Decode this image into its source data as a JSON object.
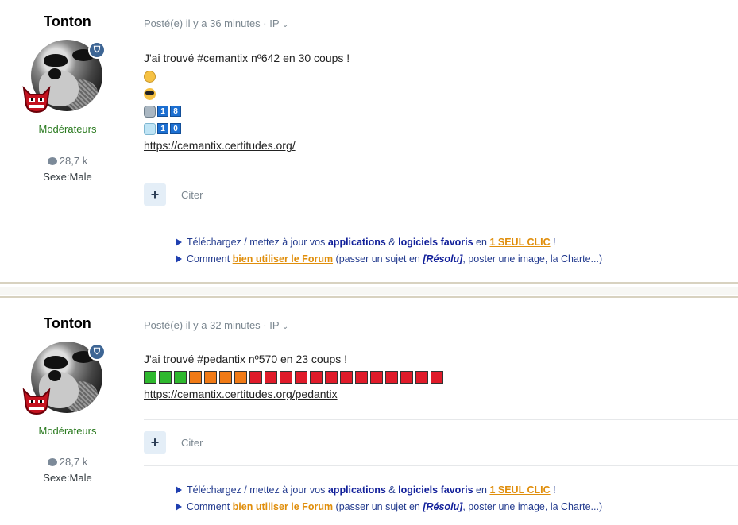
{
  "posts": [
    {
      "author": "Tonton",
      "group": "Modérateurs",
      "reputation": "28,7 k",
      "sexe": "Sexe:Male",
      "meta": "Posté(e) il y a 36 minutes · IP",
      "lines": [
        "J'ai trouvé #cemantix nº642 en 30 coups !"
      ],
      "emoji_rows": [
        {
          "icon": "dizzy-face-icon",
          "digits": []
        },
        {
          "icon": "sunglasses-face-icon",
          "digits": []
        },
        {
          "icon": "robot-face-icon",
          "digits": [
            "1",
            "8"
          ]
        },
        {
          "icon": "ice-cube-icon",
          "digits": [
            "1",
            "0"
          ]
        }
      ],
      "link": "https://cemantix.certitudes.org/",
      "reply_label": "Citer"
    },
    {
      "author": "Tonton",
      "group": "Modérateurs",
      "reputation": "28,7 k",
      "sexe": "Sexe:Male",
      "meta": "Posté(e) il y a 32 minutes · IP",
      "lines": [
        "J'ai trouvé #pedantix nº570 en 23 coups !"
      ],
      "squares": [
        "green",
        "green",
        "green",
        "orange",
        "orange",
        "orange",
        "orange",
        "red",
        "red",
        "red",
        "red",
        "red",
        "red",
        "red",
        "red",
        "red",
        "red",
        "red",
        "red",
        "red"
      ],
      "link": "https://cemantix.certitudes.org/pedantix",
      "reply_label": "Citer"
    }
  ],
  "signature": {
    "line1": {
      "pre": "Téléchargez / mettez à jour vos ",
      "b1": "applications",
      "mid": " & ",
      "b2": "logiciels favoris",
      "en": " en ",
      "orange": "1 SEUL CLIC",
      "end": " !"
    },
    "line2": {
      "pre": "Comment ",
      "orange": "bien utiliser le Forum",
      "mid": " (passer un sujet en ",
      "res": "[Résolu]",
      "end": ", poster une image, la Charte...)"
    }
  },
  "colors": {
    "green": "#2eb82e",
    "orange": "#f07a16",
    "red": "#e01b2a",
    "moderator": "#2a7a1f",
    "signature_link": "#12209a",
    "highlight": "#e08e0b"
  }
}
